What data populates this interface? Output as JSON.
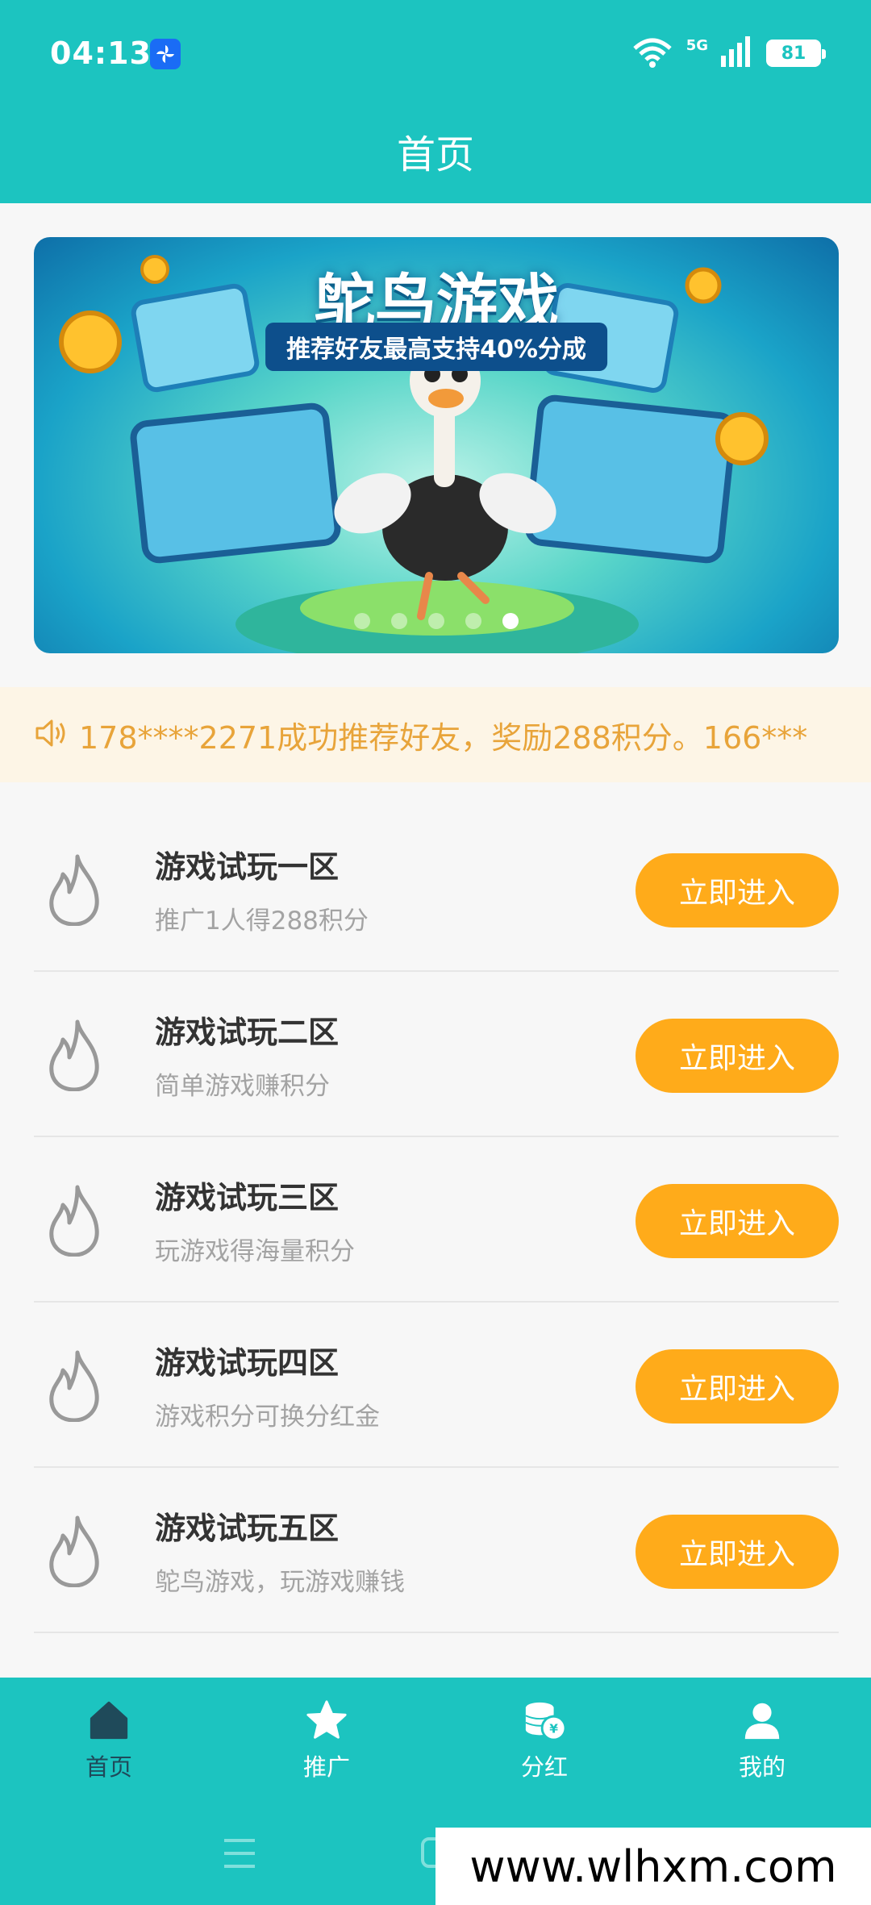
{
  "status": {
    "time": "04:13",
    "network": "5G",
    "wifi_sub": "6",
    "battery": "81"
  },
  "header": {
    "title": "首页"
  },
  "banner": {
    "title": "鸵鸟游戏",
    "subtitle": "推荐好友最高支持40%分成",
    "dots_total": 5,
    "active_dot": 4
  },
  "notice": {
    "text": "178****2271成功推荐好友，奖励288积分。166***"
  },
  "zones": [
    {
      "title": "游戏试玩一区",
      "subtitle": "推广1人得288积分",
      "button": "立即进入"
    },
    {
      "title": "游戏试玩二区",
      "subtitle": "简单游戏赚积分",
      "button": "立即进入"
    },
    {
      "title": "游戏试玩三区",
      "subtitle": "玩游戏得海量积分",
      "button": "立即进入"
    },
    {
      "title": "游戏试玩四区",
      "subtitle": "游戏积分可换分红金",
      "button": "立即进入"
    },
    {
      "title": "游戏试玩五区",
      "subtitle": "鸵鸟游戏，玩游戏赚钱",
      "button": "立即进入"
    }
  ],
  "nav": [
    {
      "label": "首页",
      "icon": "home-icon",
      "active": true
    },
    {
      "label": "推广",
      "icon": "star-icon",
      "active": false
    },
    {
      "label": "分红",
      "icon": "coins-icon",
      "active": false
    },
    {
      "label": "我的",
      "icon": "user-icon",
      "active": false
    }
  ],
  "watermark": "www.wlhxm.com",
  "colors": {
    "primary": "#1cc4c0",
    "button": "#ffab1a",
    "notice_bg": "#fdf5e6",
    "notice_text": "#e8a43a"
  }
}
